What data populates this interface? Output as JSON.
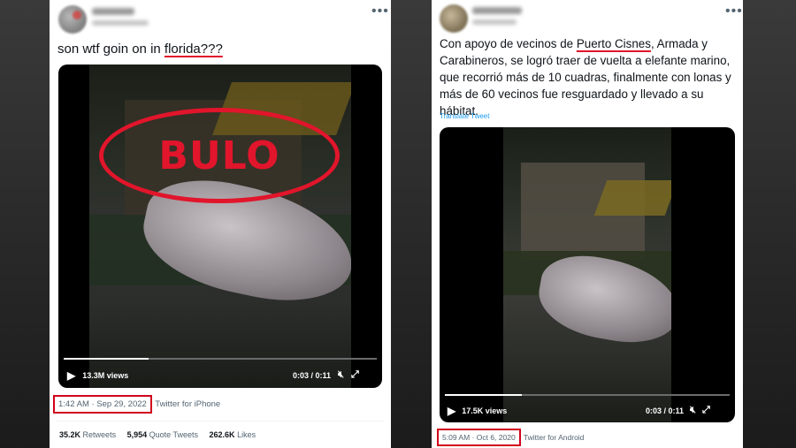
{
  "left_tweet": {
    "text_prefix": "son wtf goin on in ",
    "text_link": "florida???",
    "video": {
      "views": "13.3M views",
      "time": "0:03 / 0:11",
      "progress": 0.27
    },
    "timestamp": "1:42 AM · Sep 29, 2022",
    "source": "Twitter for iPhone",
    "stats": {
      "retweets_count": "35.2K",
      "retweets_label": "Retweets",
      "quotes_count": "5,954",
      "quotes_label": "Quote Tweets",
      "likes_count": "262.6K",
      "likes_label": "Likes"
    },
    "stamp_text": "BULO"
  },
  "right_tweet": {
    "text_part1": "Con apoyo de vecinos de ",
    "text_link": "Puerto Cisnes",
    "text_part2": ", Armada y Carabineros, se logró traer de vuelta a elefante marino, que recorrió más de 10 cuadras, finalmente con lonas y más de 60 vecinos fue resguardado y llevado a su hábitat.",
    "translate_label": "Translate Tweet",
    "video": {
      "views": "17.5K views",
      "time": "0:03 / 0:11",
      "progress": 0.27
    },
    "timestamp": "5:09 AM · Oct 6, 2020",
    "source": "Twitter for Android"
  },
  "colors": {
    "accent_red": "#e1152b",
    "link_blue": "#1d9bf0"
  },
  "icons": [
    "more-icon",
    "play-icon",
    "mute-icon",
    "fullscreen-icon"
  ]
}
